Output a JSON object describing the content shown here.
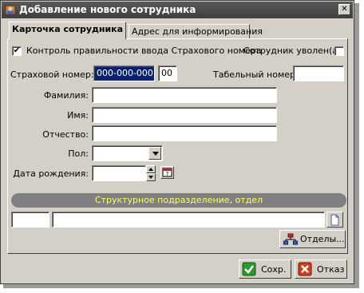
{
  "window": {
    "title": "Добавление нового сотрудника"
  },
  "tabs": [
    {
      "label": "Карточка сотрудника",
      "active": true
    },
    {
      "label": "Адрес для информирования",
      "active": false
    }
  ],
  "form": {
    "check_insurance_label": "Контроль правильности ввода Страхового номера",
    "check_insurance_checked": true,
    "fired_label": "Сотрудник уволен(а)",
    "fired_checked": false,
    "insurance_number_label": "Страховой номер:",
    "insurance_number_value": "000-000-000",
    "insurance_suffix_value": "00",
    "personnel_number_label": "Табельный номер:",
    "personnel_number_value": "",
    "surname_label": "Фамилия:",
    "surname_value": "",
    "name_label": "Имя:",
    "name_value": "",
    "patronymic_label": "Отчество:",
    "patronymic_value": "",
    "gender_label": "Пол:",
    "gender_value": "",
    "birthdate_label": "Дата рождения:",
    "birthdate_value": ""
  },
  "department": {
    "header": "Структурное подразделение, отдел",
    "code_value": "",
    "name_value": "",
    "departments_button": "Отделы..."
  },
  "footer": {
    "save_label": "Сохр.",
    "cancel_label": "Отказ"
  },
  "colors": {
    "accent_header": "#ffff66",
    "save_icon": "#2e9a2e",
    "cancel_icon": "#d04020"
  }
}
